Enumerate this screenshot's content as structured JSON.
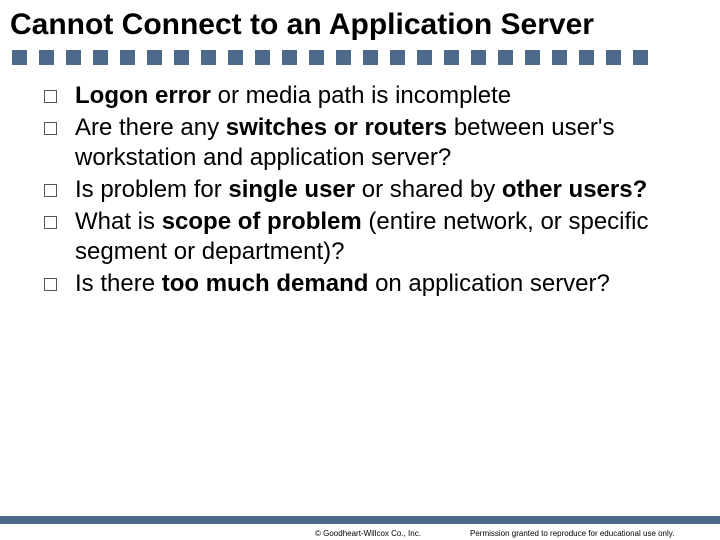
{
  "title": "Cannot Connect to an Application Server",
  "dots_count": 24,
  "bullets": [
    {
      "segments": [
        {
          "text": "Logon error ",
          "bold": true
        },
        {
          "text": "or media path is incomplete",
          "bold": false
        }
      ]
    },
    {
      "segments": [
        {
          "text": "Are there any ",
          "bold": false
        },
        {
          "text": "switches or routers ",
          "bold": true
        },
        {
          "text": "between user's workstation and application server?",
          "bold": false
        }
      ]
    },
    {
      "segments": [
        {
          "text": "Is problem for ",
          "bold": false
        },
        {
          "text": "single user ",
          "bold": true
        },
        {
          "text": "or shared by ",
          "bold": false
        },
        {
          "text": "other users?",
          "bold": true
        }
      ]
    },
    {
      "segments": [
        {
          "text": "What is ",
          "bold": false
        },
        {
          "text": "scope of problem ",
          "bold": true
        },
        {
          "text": "(entire network, or specific segment or department)?",
          "bold": false
        }
      ]
    },
    {
      "segments": [
        {
          "text": "Is there ",
          "bold": false
        },
        {
          "text": "too much demand ",
          "bold": true
        },
        {
          "text": "on application server?",
          "bold": false
        }
      ]
    }
  ],
  "footer": {
    "copyright": "© Goodheart-Willcox Co., Inc.",
    "permission": "Permission granted to reproduce for educational use only."
  }
}
